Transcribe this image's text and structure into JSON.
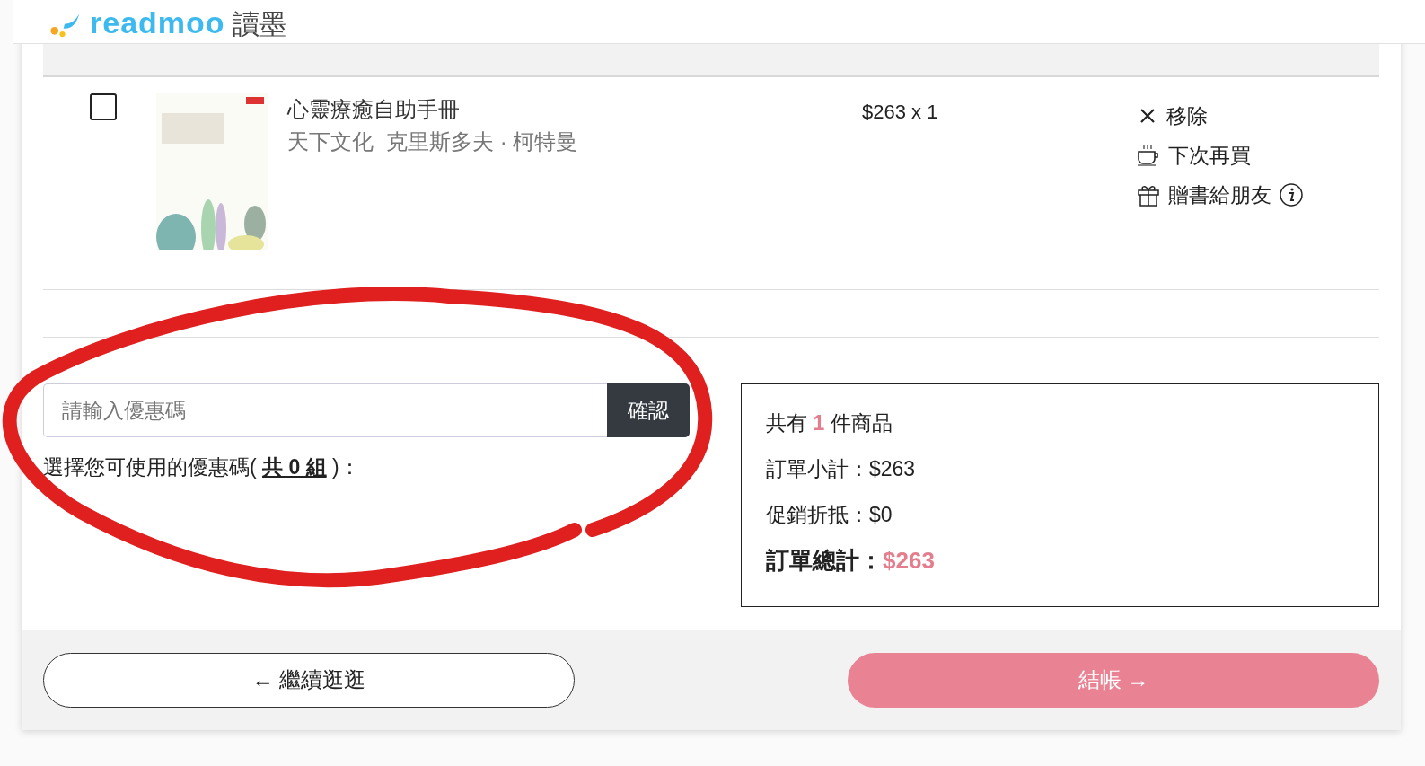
{
  "header": {
    "logo": "readmoo",
    "logo_sub": "讀墨"
  },
  "items": [
    {
      "checked": false,
      "title": "心靈療癒自助手冊",
      "publisher": "天下文化",
      "author": "克里斯多夫 · 柯特曼",
      "subtotal": "$263 x 1",
      "actions": [
        {
          "kind": "remove",
          "label": "移除"
        },
        {
          "kind": "later",
          "label": "下次再買"
        },
        {
          "kind": "gift",
          "label": "贈書給朋友"
        }
      ]
    }
  ],
  "coupon": {
    "placeholder": "請輸入優惠碼",
    "button": "確認",
    "note_prefix": "選擇您可使用的優惠碼(",
    "note_link": "共 0 組",
    "note_suffix": ")："
  },
  "summary": {
    "count_prefix": "共有",
    "count": "1",
    "count_suffix": "件商品",
    "lines": [
      "訂單小計：$263",
      "促銷折抵：$0"
    ],
    "total_label": "訂單總計：",
    "total": "$263"
  },
  "footer": {
    "back": "← 繼續逛逛",
    "checkout": "結帳 →"
  }
}
